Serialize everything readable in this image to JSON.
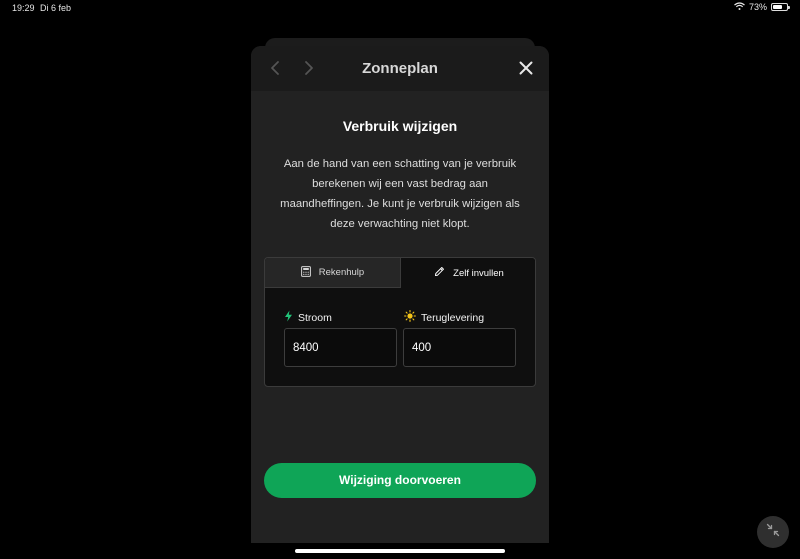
{
  "status_bar": {
    "time": "19:29",
    "date": "Di 6 feb",
    "battery": "73%",
    "battery_level": 0.73
  },
  "modal": {
    "title": "Zonneplan",
    "heading": "Verbruik wijzigen",
    "description": "Aan de hand van een schatting van je verbruik berekenen wij een vast bedrag aan maandheffingen. Je kunt je verbruik wijzigen als deze verwachting niet klopt.",
    "tabs": [
      {
        "label": "Rekenhulp",
        "icon": "calculator-icon",
        "active": false
      },
      {
        "label": "Zelf invullen",
        "icon": "pencil-icon",
        "active": true
      }
    ],
    "fields": {
      "stroom": {
        "label": "Stroom",
        "icon": "lightning-icon",
        "value": "8400"
      },
      "teruglevering": {
        "label": "Teruglevering",
        "icon": "sun-icon",
        "value": "400"
      }
    },
    "submit_label": "Wijziging doorvoeren"
  },
  "colors": {
    "accent": "#0fa557",
    "lightning": "#22c57a",
    "sun": "#f5c518"
  }
}
